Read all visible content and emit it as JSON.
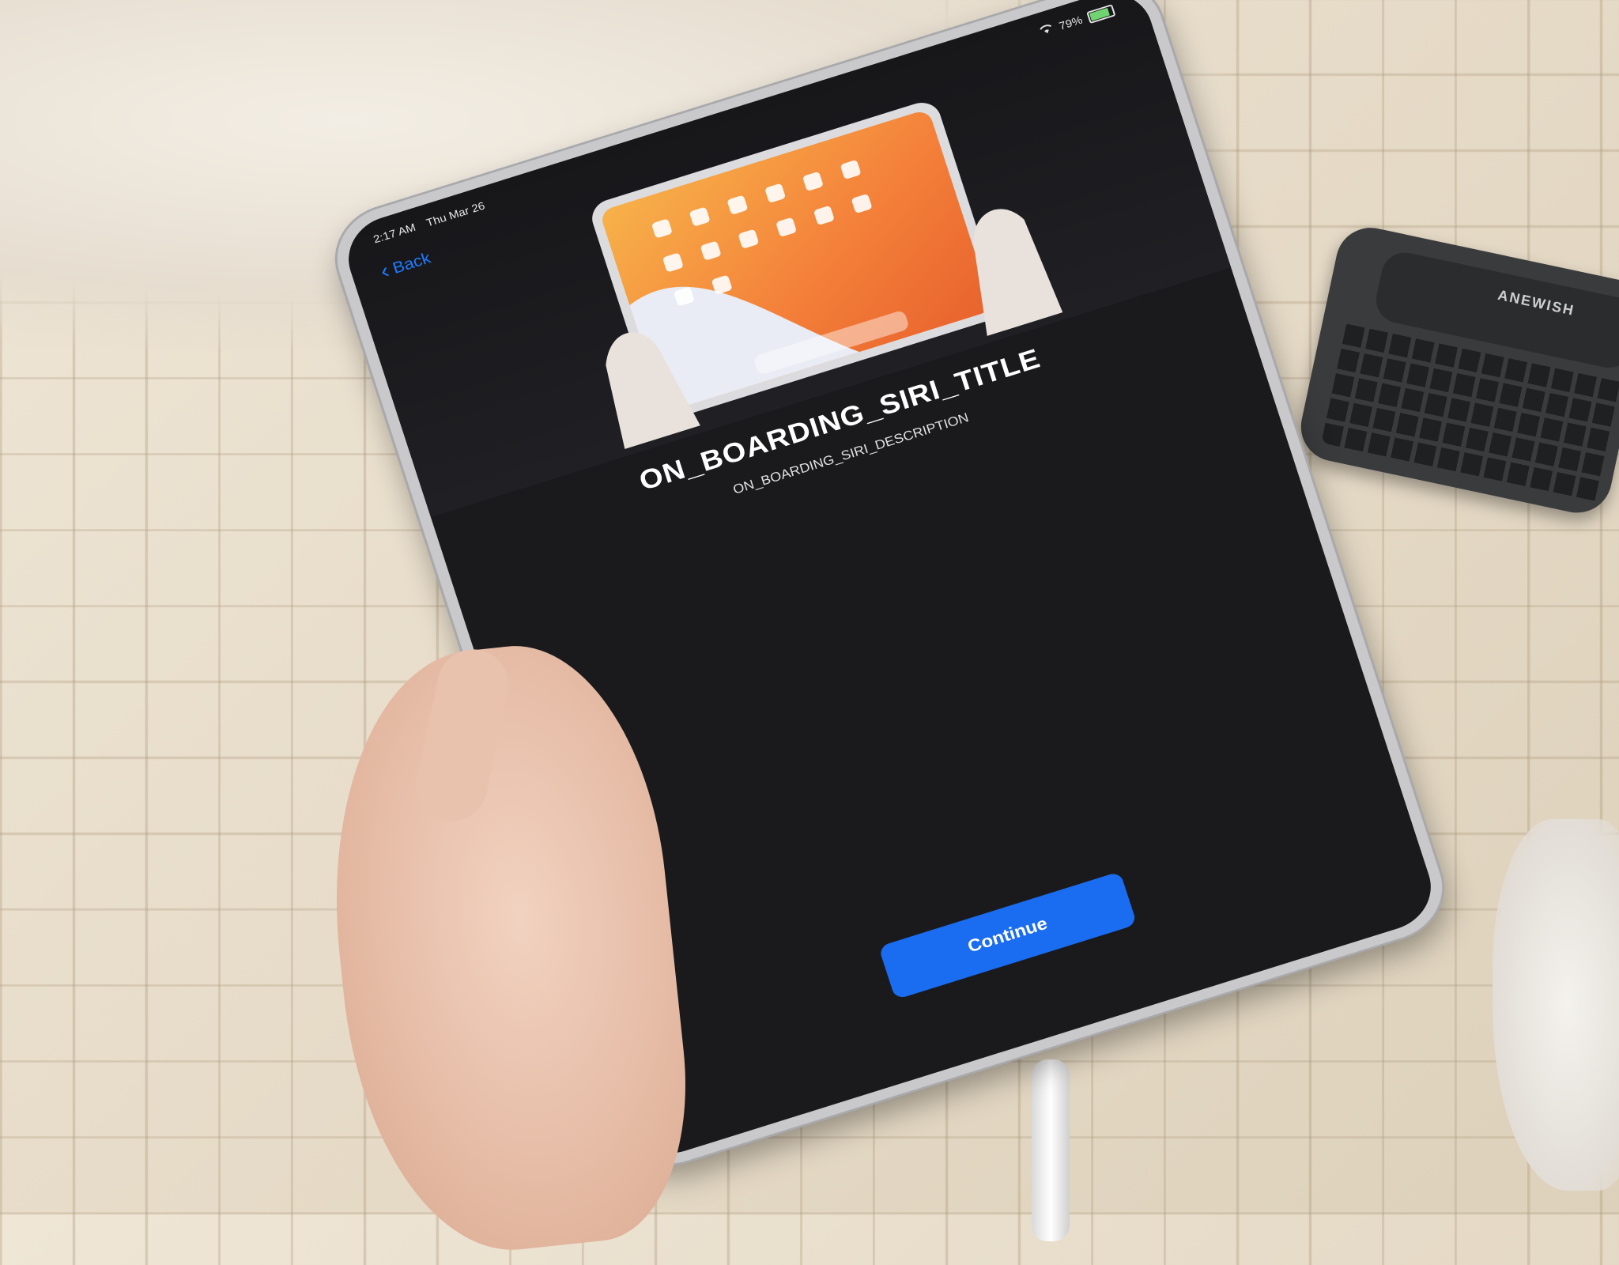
{
  "status_bar": {
    "time": "2:17 AM",
    "date": "Thu Mar 26",
    "battery": "79%"
  },
  "nav": {
    "back_label": "Back"
  },
  "onboarding": {
    "title": "ON_BOARDING_SIRI_TITLE",
    "description": "ON_BOARDING_SIRI_DESCRIPTION",
    "continue_label": "Continue"
  },
  "keyboard": {
    "brand": "ANEWISH"
  },
  "colors": {
    "accent": "#1a6cf0",
    "screen_bg": "#1a1a1d",
    "back_link": "#1e7bff"
  }
}
